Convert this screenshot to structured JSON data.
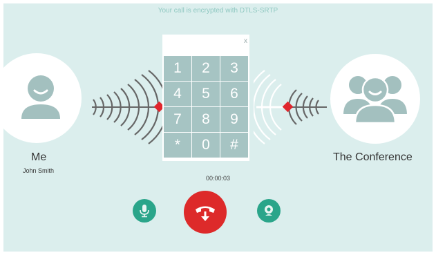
{
  "banner": {
    "text": "Your call is encrypted with DTLS-SRTP"
  },
  "me": {
    "name": "Me",
    "sub": "John Smith"
  },
  "conference": {
    "name": "The Conference"
  },
  "dialpad": {
    "close_label": "x",
    "keys": [
      "1",
      "2",
      "3",
      "4",
      "5",
      "6",
      "7",
      "8",
      "9",
      "*",
      "0",
      "#"
    ]
  },
  "timer": "00:00:03",
  "icons": {
    "me_avatar": "person-icon",
    "conference_avatar": "group-icon",
    "mic": "microphone-icon",
    "hangup": "hangup-phone-icon",
    "video": "webcam-icon"
  },
  "colors": {
    "background": "#dbeeed",
    "accent": "#2aa58a",
    "hangup": "#dd2a2a",
    "key": "#a6c4c3",
    "signal_marker": "#e0262d"
  }
}
